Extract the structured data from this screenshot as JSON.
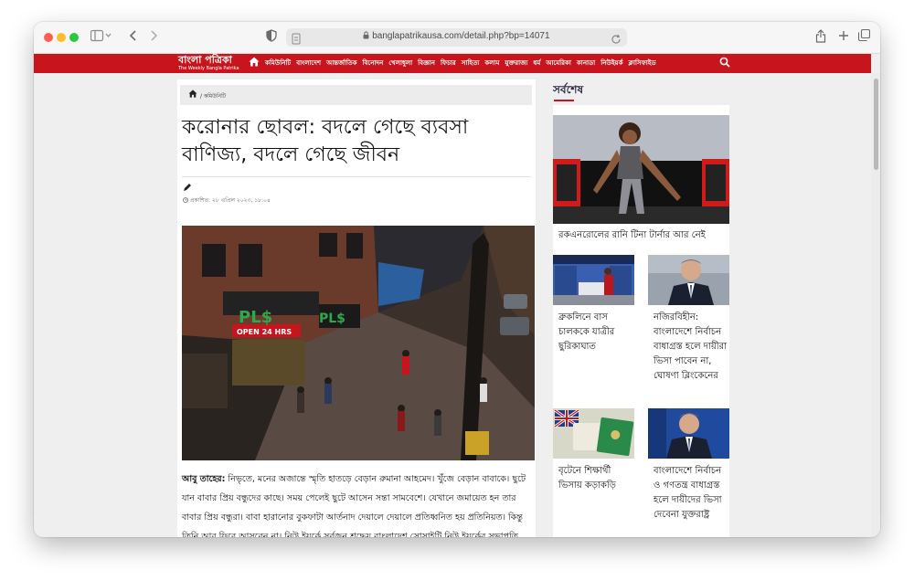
{
  "browser": {
    "url": "banglapatrikausa.com/detail.php?bp=14071"
  },
  "site": {
    "logo_text": "বাংলা পত্রিকা",
    "logo_subtitle": "The Weekly Bangla Patrika",
    "nav_items": [
      "কমিউনিটি",
      "বাংলাদেশ",
      "আন্তর্জাতিক",
      "বিনোদন",
      "খেলাধুলা",
      "বিজ্ঞান",
      "ফিচার",
      "সাহিত্য",
      "কলাম",
      "যুক্তরাজ্য",
      "ধর্ম",
      "আমেরিকা",
      "কানাডা",
      "নিউইয়র্ক",
      "ক্লাসিফাইড"
    ]
  },
  "article": {
    "breadcrumb": "কমিউনিটি",
    "title": "করোনার ছোবল: বদলে গেছে ব্যবসা বাণিজ্য, বদলে গেছে জীবন",
    "published": "প্রকাশিত: ২৮ এপ্রিল ২০২৩, ১৮:০৪",
    "author": "আবু তাহের:",
    "body": " নিভৃতে, মনের অজান্তে স্মৃতি হাতড়ে বেড়ান রুমানা আহমেদ। খুঁজে বেড়ান বাবাকে। ছুটে যান বাবার প্রিয় বন্ধুদের কাছে। সময় পেলেই ছুটে আসেন সন্তা সামবেশে। যেখানে জমায়েত হন তার বাবার প্রিয় বন্ধুরা। বাবা হারানোর বুকফাটা আর্তনাদ দেয়ালে দেয়ালে প্রতিধ্বনিত হয় প্রতিনিয়ত। কিন্তু তিনি আর ফিরে আসবেন না। নিউ ইয়র্কে সর্বজন শ্রদ্ধেয় বাংলাদেশ সোসাইটি নিউ ইয়র্কের সভাপতি",
    "store_signs": [
      "PL$",
      "OPEN 24 HRS",
      "PL$"
    ]
  },
  "sidebar": {
    "heading": "সর্বশেষ",
    "featured_title": "রকএনরোলের রানি টিনা টার্নার আর নেই",
    "cards": [
      {
        "title": "ব্রুকলিনে বাস চালককে যাত্রীর ছুরিকাঘাত"
      },
      {
        "title": "নজিরবিহীন: বাংলাদেশে নির্বাচন বাধাগ্রস্ত হলে দায়ীরা ভিসা পাবেন না, ঘোষণা ব্লিংকেনের"
      },
      {
        "title": "বৃটেনে শিক্ষার্থী ভিসায় কড়াকড়ি"
      },
      {
        "title": "বাংলাদেশে নির্বাচন ও গণতন্ত্র বাধাগ্রস্ত হলে দায়ীদের ভিসা দেবেনা যুক্তরাষ্ট্র"
      }
    ]
  },
  "colors": {
    "brand_red": "#c8141c",
    "traffic_red": "#fe5f57",
    "traffic_yellow": "#febc2e",
    "traffic_green": "#28c840"
  },
  "icons": [
    "sidebar-toggle-icon",
    "back-icon",
    "forward-icon",
    "shield-icon",
    "page-icon",
    "lock-icon",
    "reload-icon",
    "share-icon",
    "new-tab-icon",
    "tabs-icon",
    "home-icon",
    "search-icon",
    "pen-icon",
    "clock-icon"
  ]
}
